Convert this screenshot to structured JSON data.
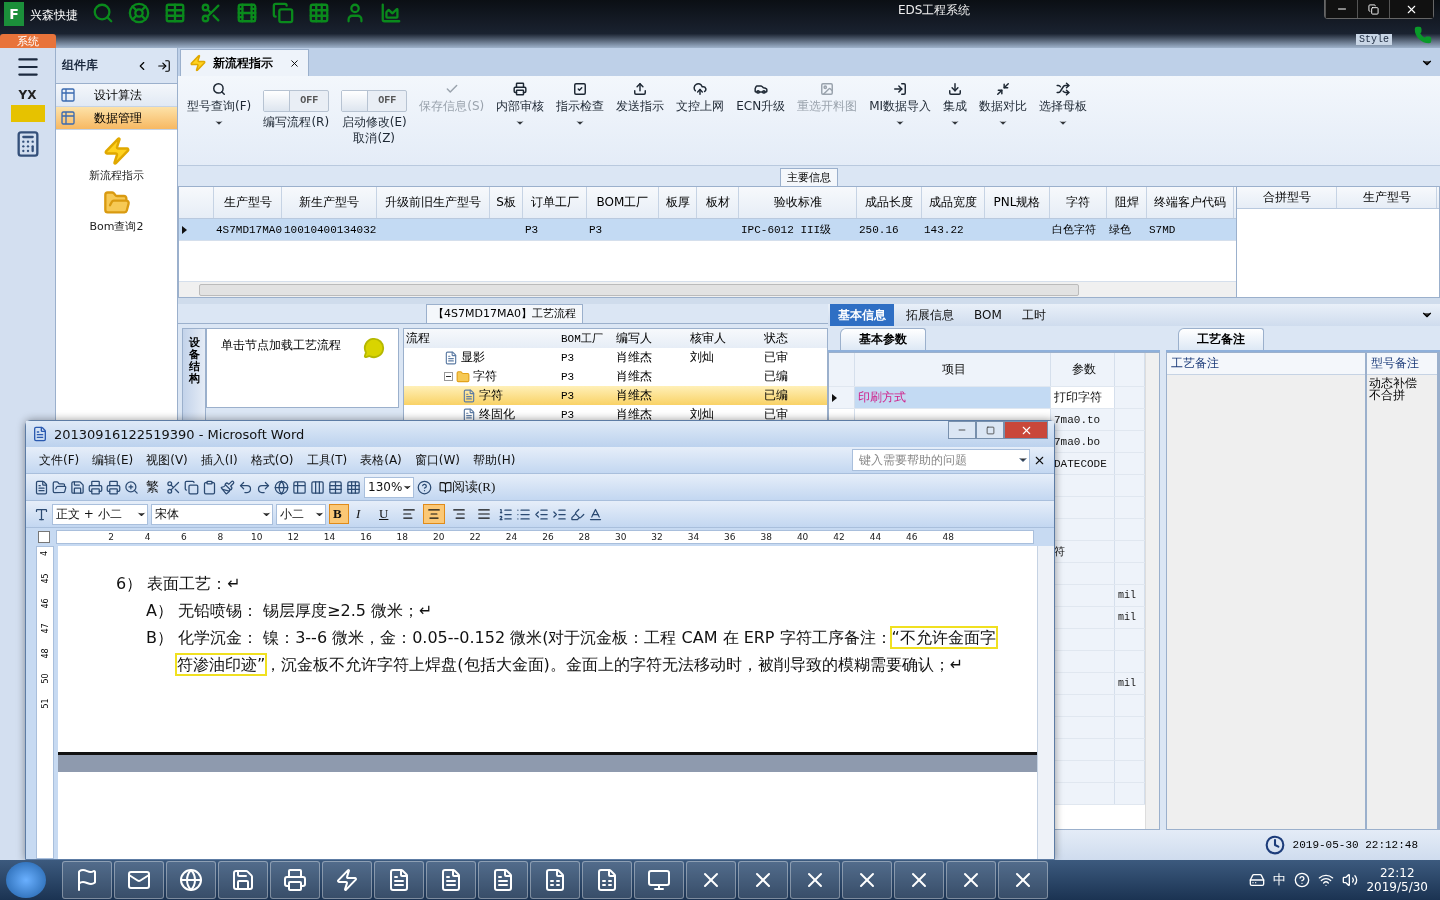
{
  "app": {
    "logo": "F",
    "brand": "兴森快捷",
    "title": "EDS工程系统",
    "menu_tab": "系统",
    "style": "Style",
    "rail_logo": "YX"
  },
  "sidebar": {
    "title": "组件库",
    "items": [
      {
        "label": "设计算法",
        "selected": false
      },
      {
        "label": "数据管理",
        "selected": true
      }
    ],
    "shortcuts": [
      {
        "kind": "bolt",
        "label": "新流程指示"
      },
      {
        "kind": "folder",
        "label": "Bom查询2"
      }
    ]
  },
  "doc_tab": {
    "label": "新流程指示"
  },
  "ribbon": {
    "buttons": [
      {
        "kind": "button",
        "label": "型号查询(F)",
        "disabled": false,
        "dropdown": true
      },
      {
        "kind": "toggle",
        "label": "编写流程(R)",
        "state": "OFF",
        "on": false
      },
      {
        "kind": "toggle",
        "label": "启动修改(E)\n取消(Z)",
        "state": "OFF",
        "on": false
      },
      {
        "kind": "button",
        "label": "保存信息(S)",
        "disabled": true,
        "dropdown": false
      },
      {
        "kind": "button",
        "label": "内部审核",
        "disabled": false,
        "dropdown": true
      },
      {
        "kind": "button",
        "label": "指示检查",
        "disabled": false,
        "dropdown": true
      },
      {
        "kind": "button",
        "label": "发送指示",
        "disabled": false,
        "dropdown": false
      },
      {
        "kind": "button",
        "label": "文控上网",
        "disabled": false,
        "dropdown": false
      },
      {
        "kind": "button",
        "label": "ECN升级",
        "disabled": false,
        "dropdown": false
      },
      {
        "kind": "button",
        "label": "重选开料图",
        "disabled": true,
        "dropdown": false
      },
      {
        "kind": "button",
        "label": "MI数据导入",
        "disabled": false,
        "dropdown": true
      },
      {
        "kind": "button",
        "label": "集成",
        "disabled": false,
        "dropdown": true
      },
      {
        "kind": "button",
        "label": "数据对比",
        "disabled": false,
        "dropdown": true
      },
      {
        "kind": "button",
        "label": "选择母板",
        "disabled": false,
        "dropdown": true
      }
    ],
    "group": "主要信息"
  },
  "main_table": {
    "columns": [
      "生产型号",
      "新生产型号",
      "升级前旧生产型号",
      "S板",
      "订单工厂",
      "BOM工厂",
      "板厚",
      "板材",
      "验收标准",
      "成品长度",
      "成品宽度",
      "PNL规格",
      "字符",
      "阻焊",
      "终端客户代码"
    ],
    "rows": [
      {
        "selected": true,
        "cells": [
          "4S7MD17MA0",
          "10010400134032",
          "",
          "",
          "P3",
          "P3",
          "",
          "",
          "IPC-6012 III级",
          "250.16",
          "143.22",
          "",
          "白色字符",
          "绿色",
          "S7MD"
        ]
      }
    ]
  },
  "side_table": {
    "columns": [
      "合拼型号",
      "生产型号"
    ]
  },
  "process": {
    "title": "【4S7MD17MA0】工艺流程",
    "vertical_tab": "设备结构",
    "hint": "单击节点加载工艺流程",
    "columns": [
      "流程",
      "BOM工厂",
      "编写人",
      "核审人",
      "状态"
    ],
    "tree": [
      {
        "kind": "file",
        "label": "显影",
        "bom": "P3",
        "writer": "肖维杰",
        "reviewer": "刘灿",
        "status": "已审",
        "selected": false
      },
      {
        "kind": "folder",
        "label": "字符",
        "bom": "P3",
        "writer": "肖维杰",
        "status": "已编",
        "selected": false,
        "expanded": true,
        "children": [
          {
            "kind": "file",
            "label": "字符",
            "bom": "P3",
            "writer": "肖维杰",
            "status": "已编",
            "selected": true
          },
          {
            "kind": "file",
            "label": "终固化",
            "bom": "P3",
            "writer": "肖维杰",
            "reviewer": "刘灿",
            "status": "已审",
            "selected": false
          }
        ]
      }
    ]
  },
  "info": {
    "tabs": [
      {
        "label": "基本信息",
        "selected": true
      },
      {
        "label": "拓展信息",
        "selected": false
      },
      {
        "label": "BOM",
        "selected": false
      },
      {
        "label": "工时",
        "selected": false
      }
    ],
    "subtab": "基本参数",
    "columns": [
      "项目",
      "参数"
    ],
    "current_row": {
      "item": "印刷方式",
      "param": "打印字符"
    },
    "rows": [
      {
        "kind": "data",
        "param": "7ma0.to"
      },
      {
        "kind": "data",
        "param": "7ma0.bo"
      },
      {
        "kind": "data",
        "param": "DATECODE"
      },
      {
        "kind": "blank"
      },
      {
        "kind": "blank"
      },
      {
        "kind": "blank"
      },
      {
        "kind": "data",
        "param": "符"
      },
      {
        "kind": "blank"
      },
      {
        "kind": "data",
        "unit": "mil"
      },
      {
        "kind": "data",
        "unit": "mil"
      },
      {
        "kind": "blank"
      },
      {
        "kind": "blank"
      },
      {
        "kind": "data",
        "unit": "mil"
      },
      {
        "kind": "blank"
      },
      {
        "kind": "blank"
      },
      {
        "kind": "blank"
      },
      {
        "kind": "blank"
      },
      {
        "kind": "blank"
      }
    ]
  },
  "notes": {
    "tab": "工艺备注",
    "columns": [
      "工艺备注",
      "型号备注"
    ],
    "model_note": "动态补偿不合拼"
  },
  "status_bar": {
    "clock": "2019-05-30 22:12:48"
  },
  "word": {
    "title": "20130916122519390 - Microsoft Word",
    "menu": [
      "文件(F)",
      "编辑(E)",
      "视图(V)",
      "插入(I)",
      "格式(O)",
      "工具(T)",
      "表格(A)",
      "窗口(W)",
      "帮助(H)"
    ],
    "help_placeholder": "键入需要帮助的问题",
    "toolbar": {
      "traditional": "繁",
      "zoom": "130%",
      "read": "阅读(R)"
    },
    "format": {
      "style": "正文 + 小二",
      "font": "宋体",
      "size": "小二",
      "buttons": [
        {
          "label": "B",
          "active": true
        },
        {
          "label": "I",
          "active": false
        },
        {
          "label": "U",
          "active": false
        }
      ],
      "align": [
        {
          "selected": false
        },
        {
          "selected": true
        },
        {
          "selected": false
        },
        {
          "selected": false
        }
      ]
    },
    "ruler": [
      "2",
      "4",
      "6",
      "8",
      "10",
      "12",
      "14",
      "16",
      "18",
      "20",
      "22",
      "24",
      "26",
      "28",
      "30",
      "32",
      "34",
      "36",
      "38",
      "40",
      "42",
      "44",
      "46",
      "48"
    ],
    "vruler": [
      "4",
      "45",
      "46",
      "47",
      "48",
      "50",
      "51"
    ],
    "paragraphs": [
      {
        "kind": "heading",
        "text": "6） 表面工艺：↵"
      },
      {
        "kind": "item",
        "text": "A） 无铅喷锡：  锡层厚度≥2.5 微米；↵"
      },
      {
        "kind": "item",
        "text": "B） 化学沉金：  镍：3--6 微米，金：0.05--0.152 微米(对于沉金板：工程 CAM 在 ERP 字符工序备注：",
        "highlight": "“不允许金面字符渗油印迹”",
        "after": "，沉金板不允许字符上焊盘(包括大金面)。金面上的字符无法移动时，被削导致的模糊需要确认；↵"
      }
    ]
  },
  "taskbar": {
    "ime": "中",
    "time": "22:12",
    "date": "2019/5/30"
  }
}
